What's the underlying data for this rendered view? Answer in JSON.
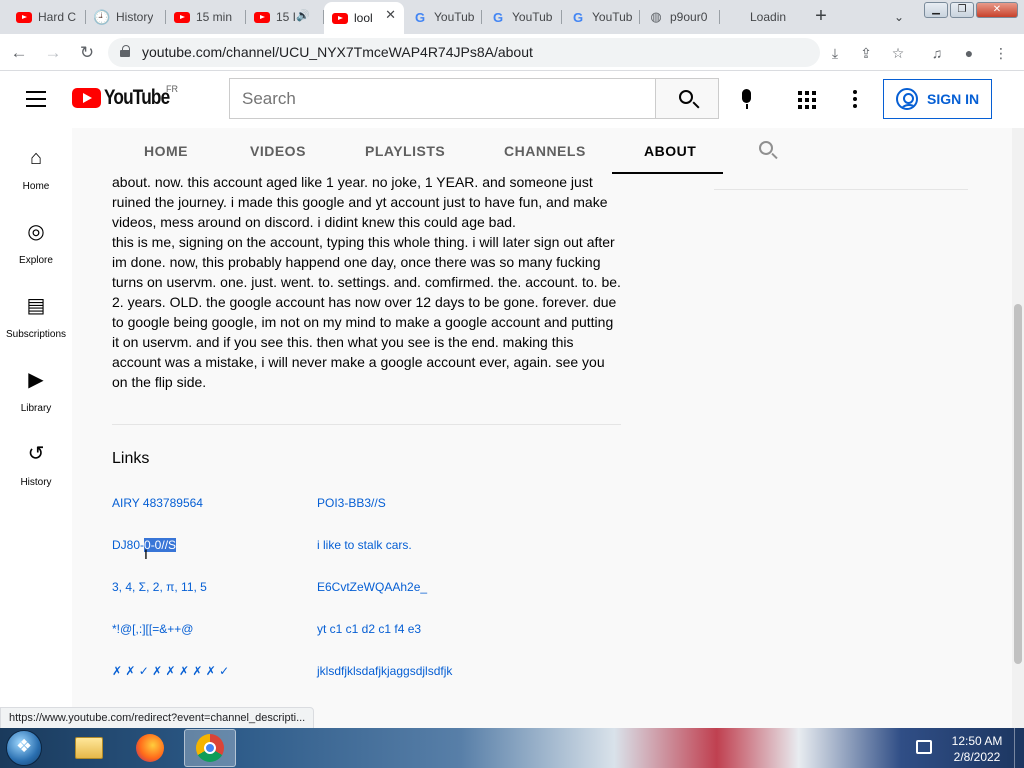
{
  "browser": {
    "tabs": [
      {
        "title": "Hard C",
        "icon": "youtube-icon",
        "active": false
      },
      {
        "title": "History",
        "icon": "history-icon",
        "active": false
      },
      {
        "title": "15 min",
        "icon": "youtube-icon",
        "active": false
      },
      {
        "title": "15 I",
        "icon": "youtube-icon",
        "active": false,
        "audio": true
      },
      {
        "title": "lool",
        "icon": "youtube-icon",
        "active": true
      },
      {
        "title": "YouTub",
        "icon": "google-icon",
        "active": false
      },
      {
        "title": "YouTub",
        "icon": "google-icon",
        "active": false
      },
      {
        "title": "YouTub",
        "icon": "google-icon",
        "active": false
      },
      {
        "title": "p9our0",
        "icon": "globe-icon",
        "active": false
      },
      {
        "title": "Loadin",
        "icon": "none",
        "active": false
      }
    ],
    "url": "youtube.com/channel/UCU_NYX7TmceWAP4R74JPs8A/about",
    "status_url": "https://www.youtube.com/redirect?event=channel_descripti..."
  },
  "youtube": {
    "logo_text": "YouTube",
    "country_code": "FR",
    "search_placeholder": "Search",
    "signin_label": "SIGN IN"
  },
  "guide": [
    {
      "label": "Home",
      "icon": "home-icon"
    },
    {
      "label": "Explore",
      "icon": "compass-icon"
    },
    {
      "label": "Subscriptions",
      "icon": "subscriptions-icon"
    },
    {
      "label": "Library",
      "icon": "library-icon"
    },
    {
      "label": "History",
      "icon": "history-icon"
    }
  ],
  "channel_tabs": [
    "HOME",
    "VIDEOS",
    "PLAYLISTS",
    "CHANNELS",
    "ABOUT"
  ],
  "active_tab": "ABOUT",
  "description": {
    "line1": "about. now. this account aged like 1 year. no joke, 1 YEAR. and someone just ruined the journey. i made this google and yt account just to have fun, and make videos, mess around on discord. i didint knew this could age bad.",
    "line2": "this is me, signing on the account, typing this whole thing. i will later sign out after im done. now, this probably happend one day, once there was so many fucking turns on uservm. one. just. went. to. settings. and. comfirmed. the. account. to. be. 2. years. OLD. the google account has now over 12 days to be gone. forever. due to google being google, im not on my mind to make a google account and putting it on uservm. and if you see this. then what you see is the end. making this account was a mistake, i will never make a google account ever, again. see you on the flip side."
  },
  "links_title": "Links",
  "links": [
    {
      "text": "AIRY 483789564"
    },
    {
      "text": "POI3-BB3//S"
    },
    {
      "text_pre": "DJ80-",
      "text_sel": "0-0//S"
    },
    {
      "text": "i like to stalk cars."
    },
    {
      "text": "3, 4, Σ, 2, π, 11, 5"
    },
    {
      "text": "E6CvtZeWQAAh2e_"
    },
    {
      "text": "*!@[,:][[=&++@"
    },
    {
      "text": "yt c1 c1 d2 c1 f4 e3"
    },
    {
      "text": "✗ ✗ ✓ ✗ ✗ ✗ ✗ ✗ ✓"
    },
    {
      "text": "jklsdfjklsdafjkjaggsdjlsdfjk"
    }
  ],
  "taskbar": {
    "time": "12:50 AM",
    "date": "2/8/2022"
  }
}
